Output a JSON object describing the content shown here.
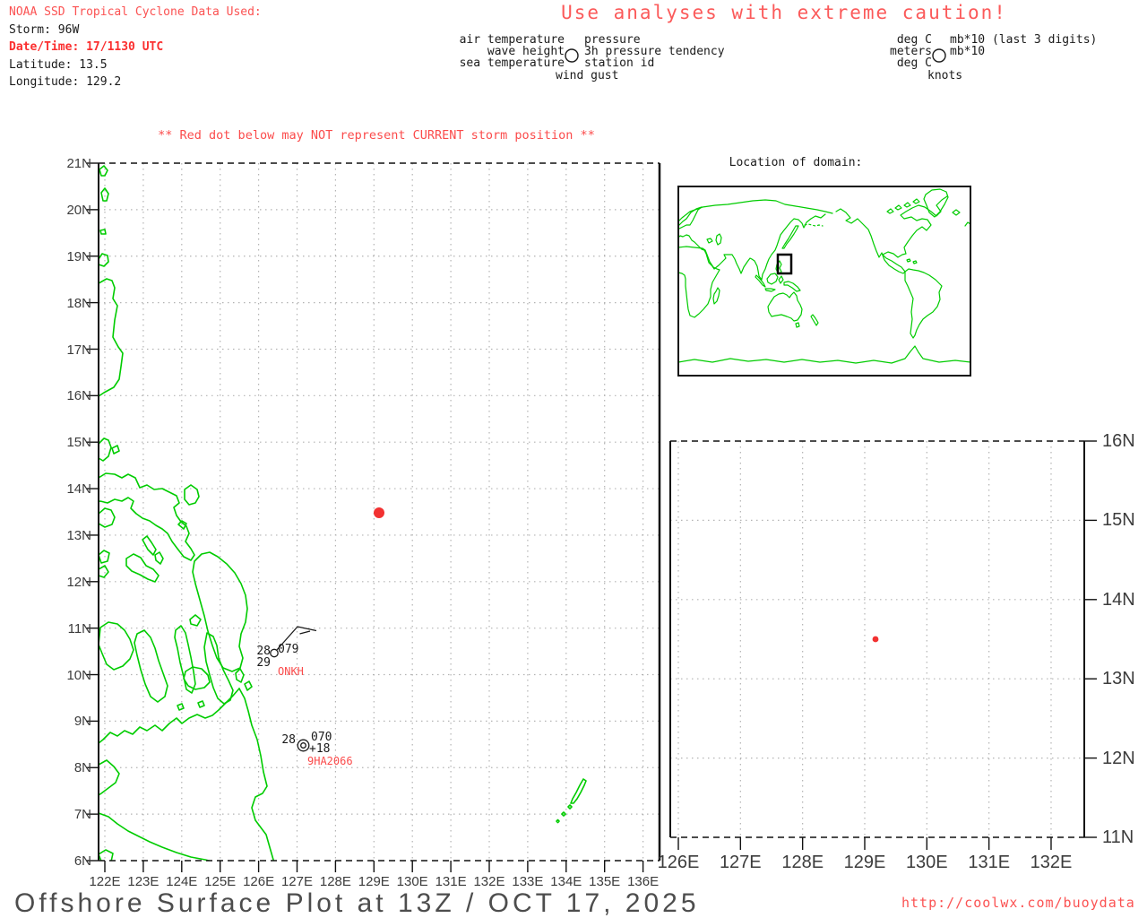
{
  "header": {
    "title": "NOAA SSD Tropical Cyclone Data Used:",
    "storm": "Storm: 96W",
    "datetime": "Date/Time: 17/1130 UTC",
    "latitude": "Latitude: 13.5",
    "longitude": "Longitude: 129.2"
  },
  "caution": "Use analyses with extreme caution!",
  "warning": "** Red dot below may NOT represent CURRENT storm position **",
  "legend": {
    "air_label": "air temperature",
    "wave_label": "wave height",
    "sea_label": "sea temperature",
    "wind_label": "wind gust",
    "pressure_label": "pressure",
    "tendency_label": "3h pressure tendency",
    "station_label": "station id",
    "air_unit": "deg C",
    "wave_unit": "meters",
    "sea_unit": "deg C",
    "wind_unit": "knots",
    "pressure_unit": "mb*10 (last 3 digits)",
    "tendency_unit": "mb*10"
  },
  "world_inset": {
    "title": "Location of domain:"
  },
  "main_map": {
    "lat_ticks": [
      "21N",
      "20N",
      "19N",
      "18N",
      "17N",
      "16N",
      "15N",
      "14N",
      "13N",
      "12N",
      "11N",
      "10N",
      "9N",
      "8N",
      "7N",
      "6N"
    ],
    "lon_ticks": [
      "122E",
      "123E",
      "124E",
      "125E",
      "126E",
      "127E",
      "128E",
      "129E",
      "130E",
      "131E",
      "132E",
      "133E",
      "134E",
      "135E",
      "136E"
    ]
  },
  "inset_map": {
    "lat_ticks": [
      "16N",
      "15N",
      "14N",
      "13N",
      "12N",
      "11N"
    ],
    "lon_ticks": [
      "126E",
      "127E",
      "128E",
      "129E",
      "130E",
      "131E",
      "132E"
    ]
  },
  "storm": {
    "lat": 13.5,
    "lon": 129.2
  },
  "stations": [
    {
      "id": "ONKH",
      "air_temp": "28",
      "sea_temp": "29",
      "pressure": "079"
    },
    {
      "id": "9HA2066",
      "air_temp": "28",
      "pressure": "070",
      "tendency": "+18"
    }
  ],
  "footer": {
    "title": "Offshore Surface Plot at 13Z / OCT 17, 2025",
    "url": "http://coolwx.com/buoydata"
  },
  "colors": {
    "accent_red": "#fb5252",
    "bold_red": "#fb2f2f",
    "map_green": "#00cc00",
    "dot_red": "#f23131",
    "axis_gray": "#3c3c3c"
  }
}
